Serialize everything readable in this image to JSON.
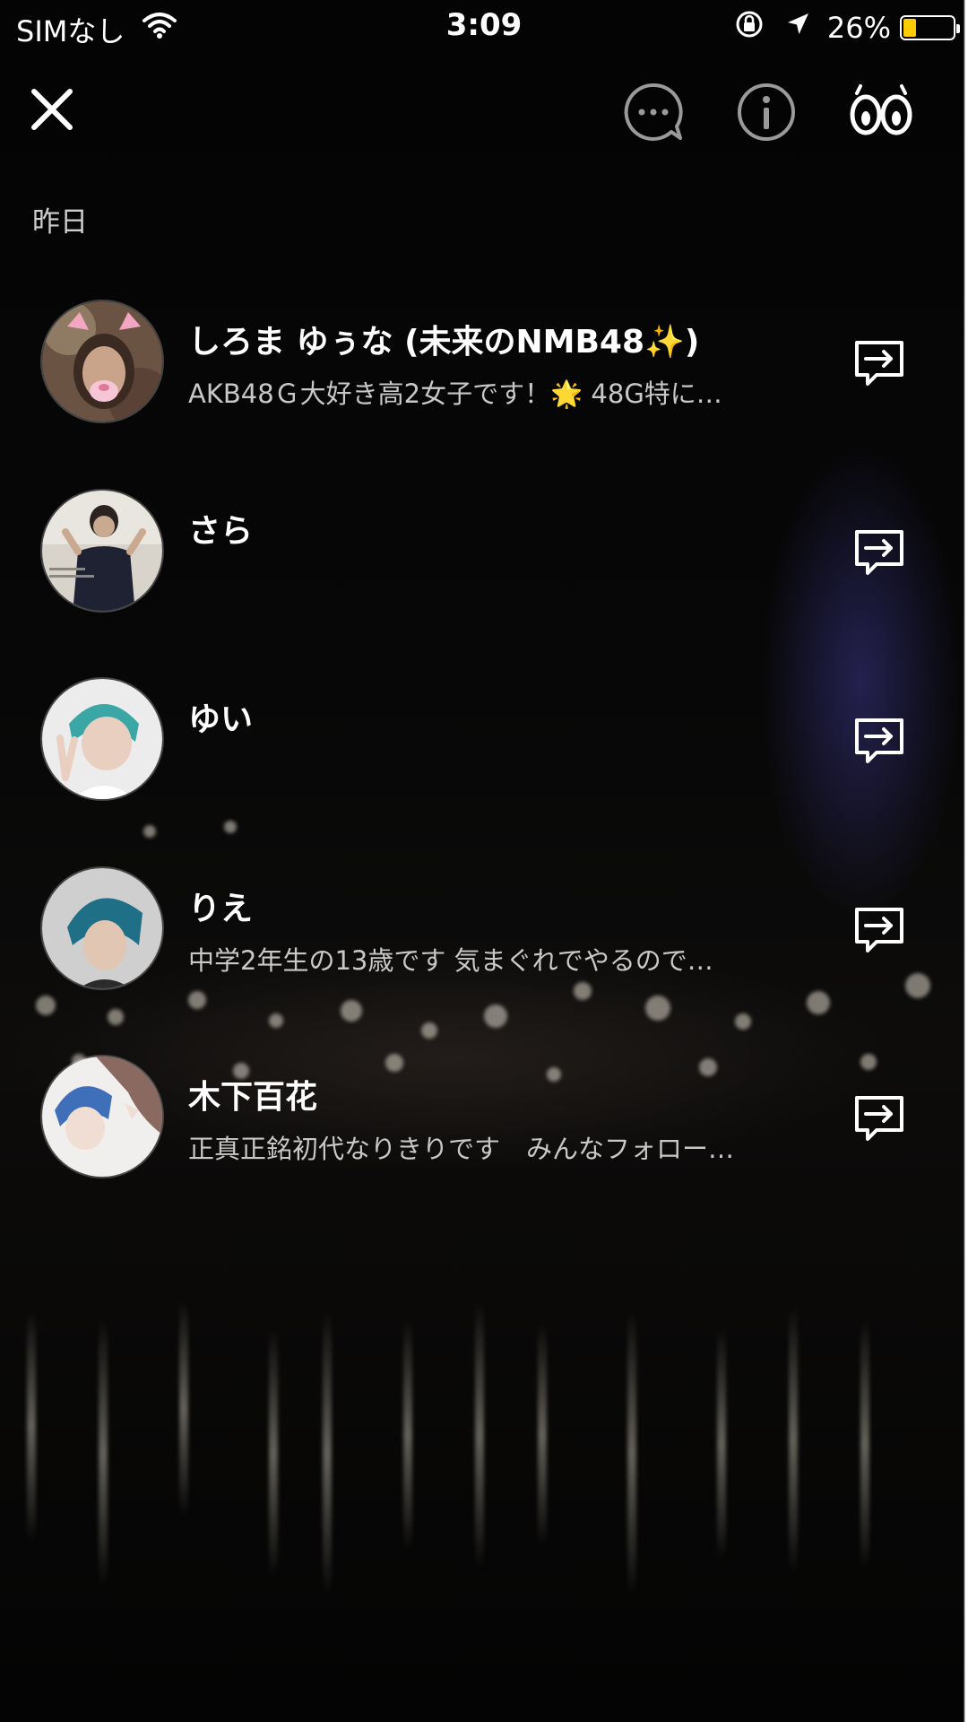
{
  "status_bar": {
    "carrier": "SIMなし",
    "time": "3:09",
    "battery_percent": "26%",
    "battery_level": 0.26,
    "battery_color": "#ffcc00"
  },
  "header": {
    "close_icon": "close-icon",
    "icons": [
      "chat-bubble-icon",
      "info-icon",
      "binoculars-icon"
    ]
  },
  "section_label": "昨日",
  "users": [
    {
      "name": "しろま ゆぅな (未来のNMB48✨)",
      "bio": "AKB48Ｇ大好き高2女子です！🌟 48G特に…"
    },
    {
      "name": "さら",
      "bio": ""
    },
    {
      "name": "ゆい",
      "bio": ""
    },
    {
      "name": "りえ",
      "bio": "中学2年生の13歳です 気まぐれでやるので…"
    },
    {
      "name": "木下百花",
      "bio": "正真正銘初代なりきりです　みんなフォロー…"
    }
  ],
  "colors": {
    "background": "#050505",
    "text_primary": "#ffffff",
    "text_secondary": "#c8c8c8",
    "accent_battery": "#ffcc00"
  }
}
